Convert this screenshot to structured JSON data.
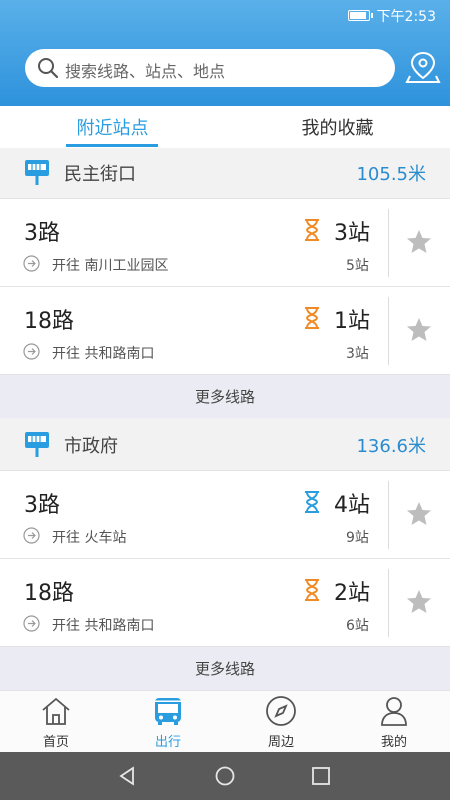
{
  "status_bar": {
    "time": "下午2:53",
    "battery_percent": 80
  },
  "search": {
    "placeholder": "搜索线路、站点、地点"
  },
  "tabs": [
    {
      "label": "附近站点",
      "active": true
    },
    {
      "label": "我的收藏",
      "active": false
    }
  ],
  "stops": [
    {
      "name": "民主街口",
      "distance": "105.5米",
      "routes": [
        {
          "name": "3路",
          "direction": "开往 南川工业园区",
          "stops_away": "3站",
          "total": "5站",
          "hourglass_color": "#f08a24"
        },
        {
          "name": "18路",
          "direction": "开往 共和路南口",
          "stops_away": "1站",
          "total": "3站",
          "hourglass_color": "#f08a24"
        }
      ],
      "more_label": "更多线路"
    },
    {
      "name": "市政府",
      "distance": "136.6米",
      "routes": [
        {
          "name": "3路",
          "direction": "开往 火车站",
          "stops_away": "4站",
          "total": "9站",
          "hourglass_color": "#2a9de0"
        },
        {
          "name": "18路",
          "direction": "开往 共和路南口",
          "stops_away": "2站",
          "total": "6站",
          "hourglass_color": "#f08a24"
        }
      ],
      "more_label": "更多线路"
    }
  ],
  "bottom_nav": [
    {
      "label": "首页",
      "icon": "home-icon",
      "active": false
    },
    {
      "label": "出行",
      "icon": "bus-icon",
      "active": true
    },
    {
      "label": "周边",
      "icon": "compass-icon",
      "active": false
    },
    {
      "label": "我的",
      "icon": "user-icon",
      "active": false
    }
  ],
  "colors": {
    "accent": "#2a9de0",
    "header": "#2e92dc",
    "orange": "#f08a24"
  }
}
